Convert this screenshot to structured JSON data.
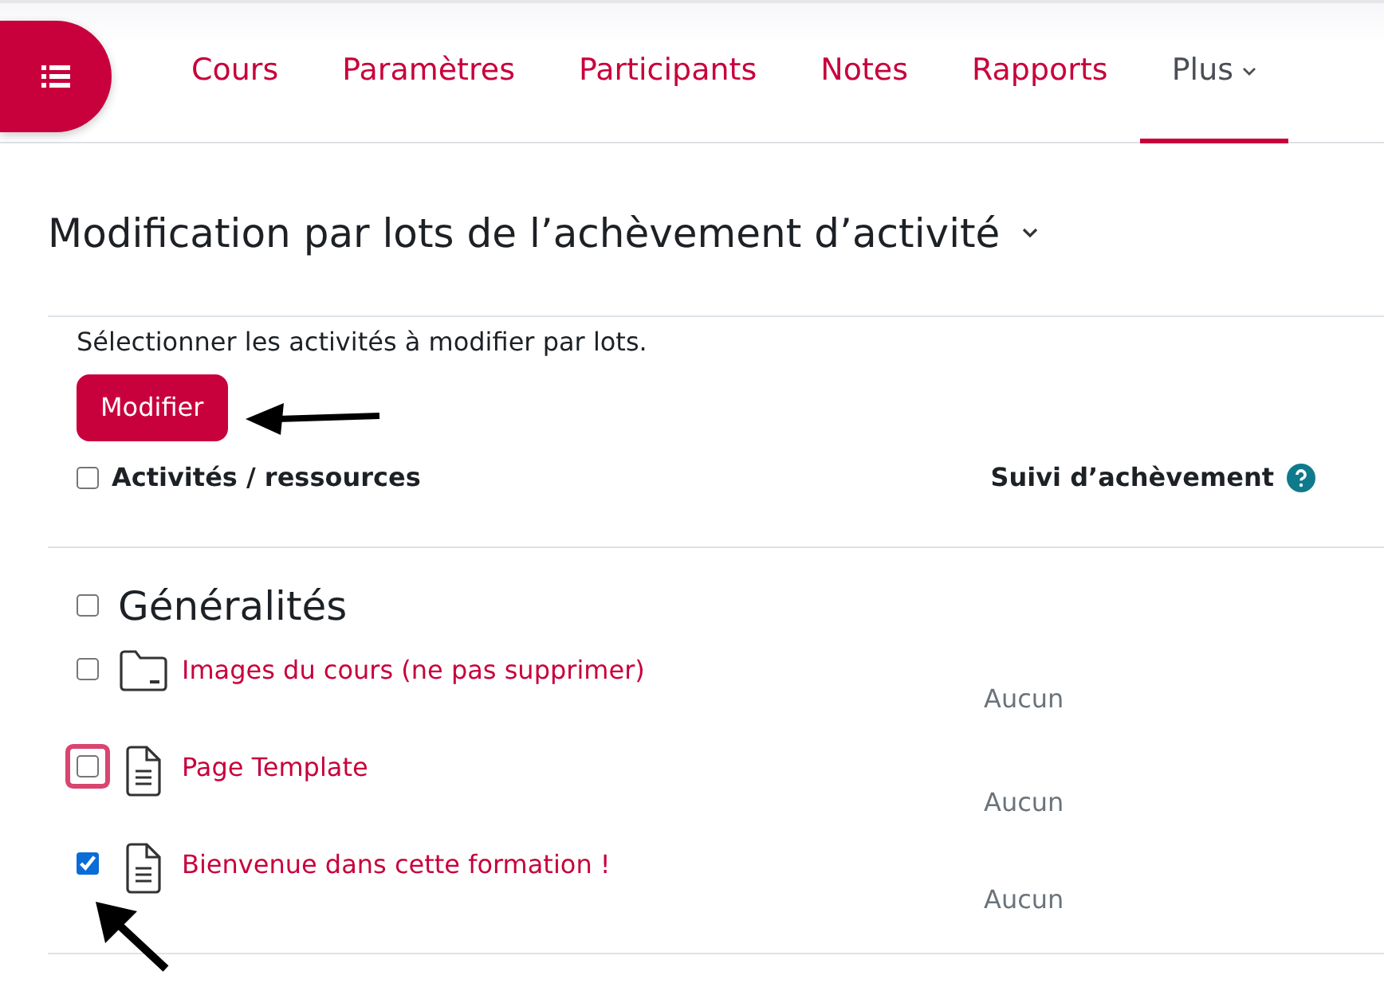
{
  "nav": {
    "tabs": [
      {
        "label": "Cours",
        "selected": false
      },
      {
        "label": "Paramètres",
        "selected": false
      },
      {
        "label": "Participants",
        "selected": false
      },
      {
        "label": "Notes",
        "selected": false
      },
      {
        "label": "Rapports",
        "selected": false
      },
      {
        "label": "Plus",
        "selected": true,
        "kind": "dropdown"
      }
    ]
  },
  "heading": "Modification par lots de l’achèvement d’activité",
  "instruction": "Sélectionner les activités à modifier par lots.",
  "button": "Modifier",
  "table": {
    "select_all_checked": false,
    "columns": [
      "Activités / ressources",
      "Suivi d’achèvement"
    ],
    "section": {
      "title": "Généralités",
      "checked": false
    },
    "rows": [
      {
        "kind": "folder",
        "name": "Images du cours (ne pas supprimer)",
        "completion": "Aucun",
        "checked": false,
        "focused": false
      },
      {
        "kind": "page",
        "name": "Page Template",
        "completion": "Aucun",
        "checked": false,
        "focused": true
      },
      {
        "kind": "page",
        "name": "Bienvenue dans cette formation !",
        "completion": "Aucun",
        "checked": true,
        "focused": false
      }
    ]
  }
}
